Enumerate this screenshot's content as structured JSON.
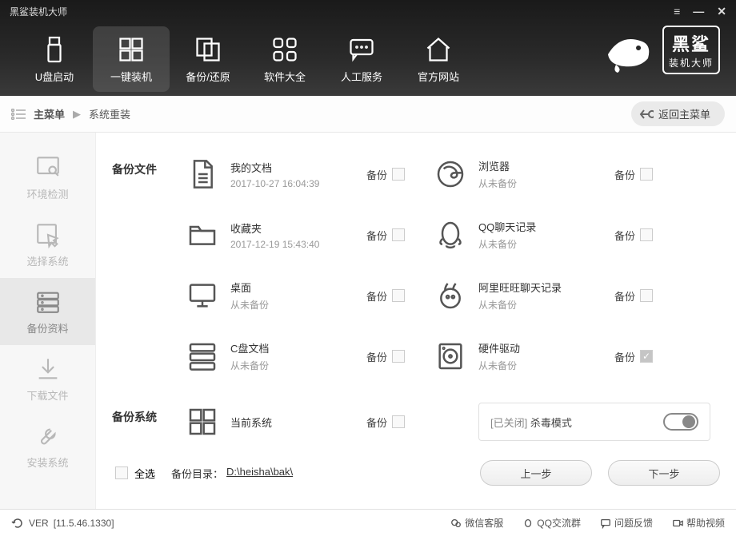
{
  "app": {
    "title": "黑鲨装机大师"
  },
  "logo": {
    "line1": "黑鲨",
    "line2": "装机大师"
  },
  "nav": {
    "items": [
      {
        "label": "U盘启动"
      },
      {
        "label": "一键装机"
      },
      {
        "label": "备份/还原"
      },
      {
        "label": "软件大全"
      },
      {
        "label": "人工服务"
      },
      {
        "label": "官方网站"
      }
    ]
  },
  "breadcrumb": {
    "main": "主菜单",
    "current": "系统重装",
    "back": "返回主菜单"
  },
  "sidebar": {
    "steps": [
      {
        "label": "环境检测"
      },
      {
        "label": "选择系统"
      },
      {
        "label": "备份资料"
      },
      {
        "label": "下载文件"
      },
      {
        "label": "安装系统"
      }
    ]
  },
  "sections": {
    "files_label": "备份文件",
    "system_label": "备份系统",
    "rows": [
      {
        "left": {
          "title": "我的文档",
          "sub": "2017-10-27 16:04:39"
        },
        "right": {
          "title": "浏览器",
          "sub": "从未备份"
        }
      },
      {
        "left": {
          "title": "收藏夹",
          "sub": "2017-12-19 15:43:40"
        },
        "right": {
          "title": "QQ聊天记录",
          "sub": "从未备份"
        }
      },
      {
        "left": {
          "title": "桌面",
          "sub": "从未备份"
        },
        "right": {
          "title": "阿里旺旺聊天记录",
          "sub": "从未备份"
        }
      },
      {
        "left": {
          "title": "C盘文档",
          "sub": "从未备份"
        },
        "right": {
          "title": "硬件驱动",
          "sub": "从未备份",
          "checked": true
        }
      }
    ],
    "system_row": {
      "title": "当前系统"
    },
    "backup_label": "备份"
  },
  "antivirus": {
    "status": "[已关闭]",
    "label": "杀毒模式"
  },
  "footer": {
    "select_all": "全选",
    "dir_label": "备份目录：",
    "dir_path": "D:\\heisha\\bak\\",
    "prev": "上一步",
    "next": "下一步"
  },
  "status": {
    "version_label": "VER",
    "version": "[11.5.46.1330]",
    "items": [
      {
        "label": "微信客服"
      },
      {
        "label": "QQ交流群"
      },
      {
        "label": "问题反馈"
      },
      {
        "label": "帮助视频"
      }
    ]
  }
}
